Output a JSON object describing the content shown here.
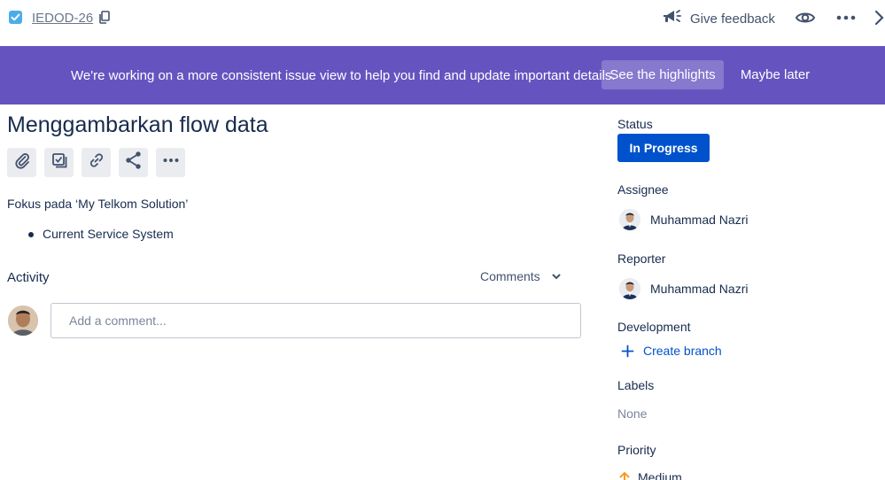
{
  "header": {
    "issue_key": "IEDOD-26",
    "feedback_label": "Give feedback"
  },
  "banner": {
    "message": "We're working on a more consistent issue view to help you find and update important details.",
    "primary_label": "See the highlights",
    "secondary_label": "Maybe later",
    "color": "#6554c0"
  },
  "issue": {
    "title": "Menggambarkan flow data",
    "description": "Fokus pada ‘My Telkom Solution’",
    "bullets": [
      "Current Service System"
    ]
  },
  "toolbar": {
    "icons": [
      "attachment-icon",
      "subtask-icon",
      "link-icon",
      "share-icon",
      "more-icon"
    ]
  },
  "activity": {
    "heading": "Activity",
    "filter_value": "Comments",
    "comment_placeholder": "Add a comment..."
  },
  "sidebar": {
    "status_label": "Status",
    "status_value": "In Progress",
    "status_color": "#0052cc",
    "assignee_label": "Assignee",
    "assignee_name": "Muhammad Nazri",
    "reporter_label": "Reporter",
    "reporter_name": "Muhammad Nazri",
    "development_label": "Development",
    "create_branch_label": "Create branch",
    "labels_label": "Labels",
    "labels_value": "None",
    "priority_label": "Priority",
    "priority_value": "Medium",
    "priority_color": "#ff991f"
  }
}
